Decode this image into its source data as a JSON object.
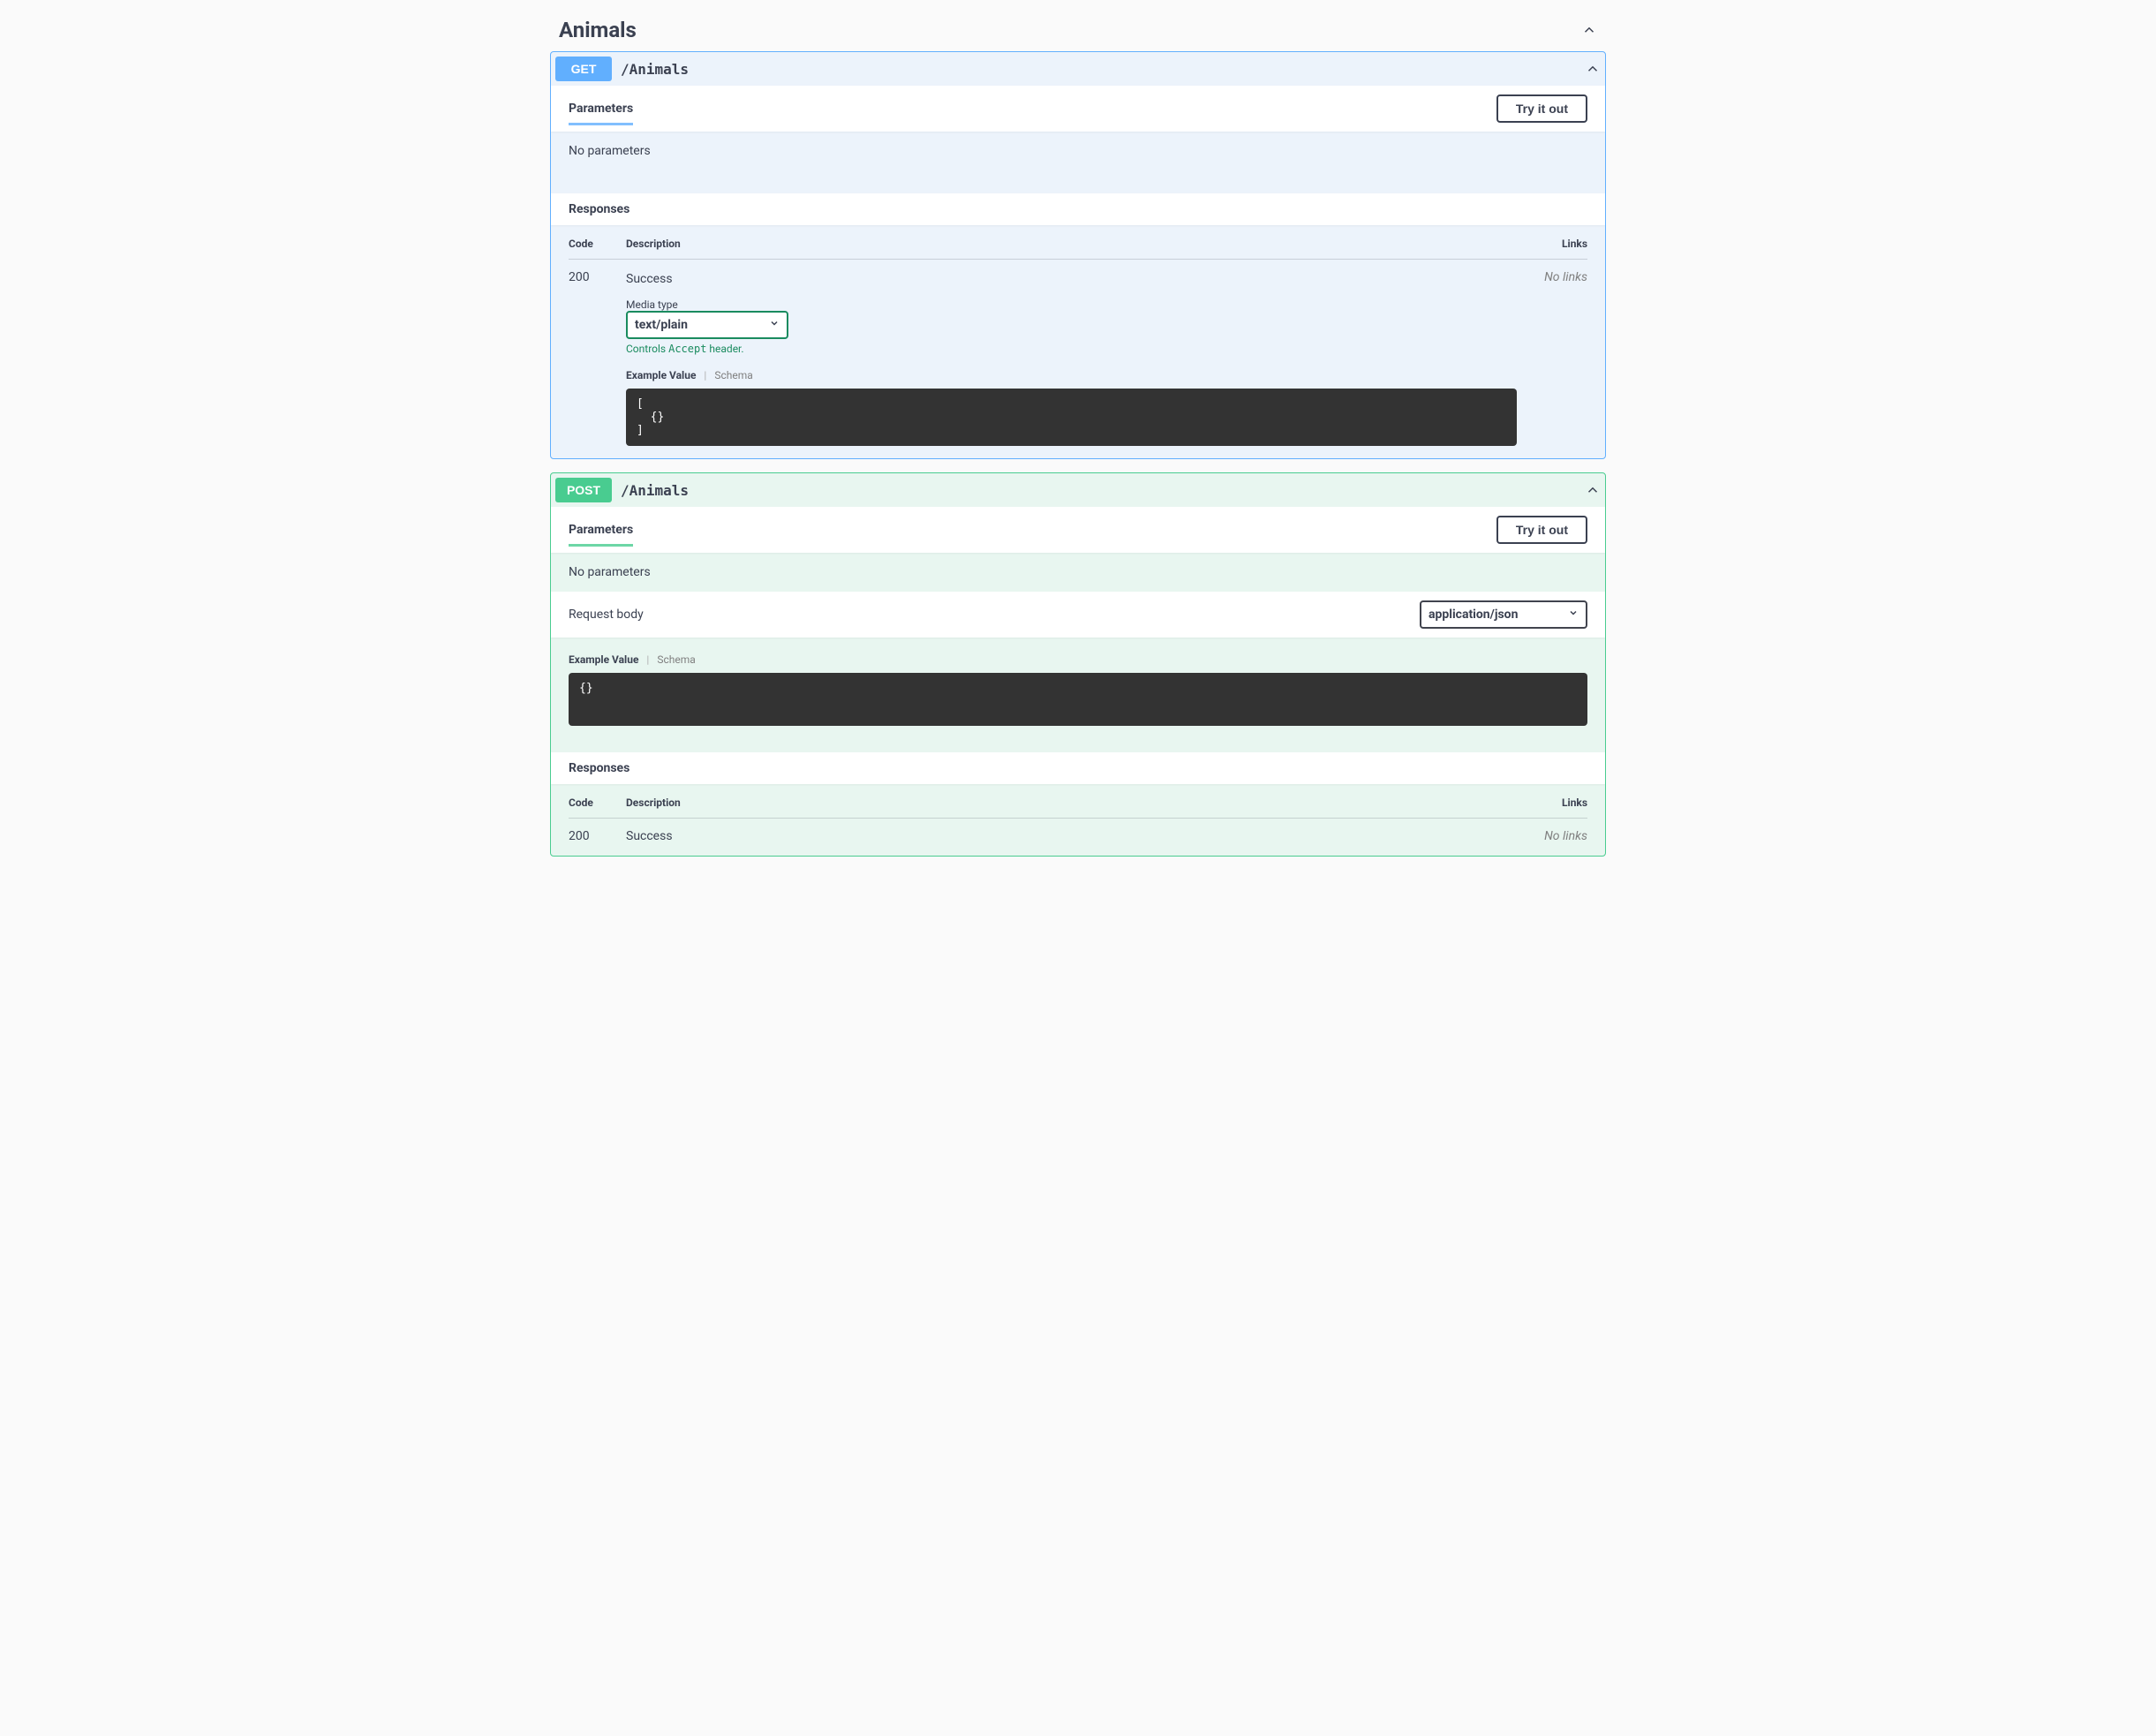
{
  "tag": {
    "name": "Animals"
  },
  "labels": {
    "parameters": "Parameters",
    "responses": "Responses",
    "try": "Try it out",
    "no_params": "No parameters",
    "request_body": "Request body",
    "th_code": "Code",
    "th_desc": "Description",
    "th_links": "Links",
    "no_links": "No links",
    "media_type": "Media type",
    "controls_accept_pre": "Controls ",
    "controls_accept_code": "Accept",
    "controls_accept_post": " header.",
    "example_value": "Example Value",
    "schema": "Schema"
  },
  "ops": {
    "get": {
      "method": "GET",
      "path": "/Animals",
      "response": {
        "code": "200",
        "desc": "Success",
        "media_type": "text/plain",
        "example": "[\n  {}\n]"
      }
    },
    "post": {
      "method": "POST",
      "path": "/Animals",
      "request_body": {
        "content_type": "application/json",
        "example": "{}"
      },
      "response": {
        "code": "200",
        "desc": "Success"
      }
    }
  }
}
